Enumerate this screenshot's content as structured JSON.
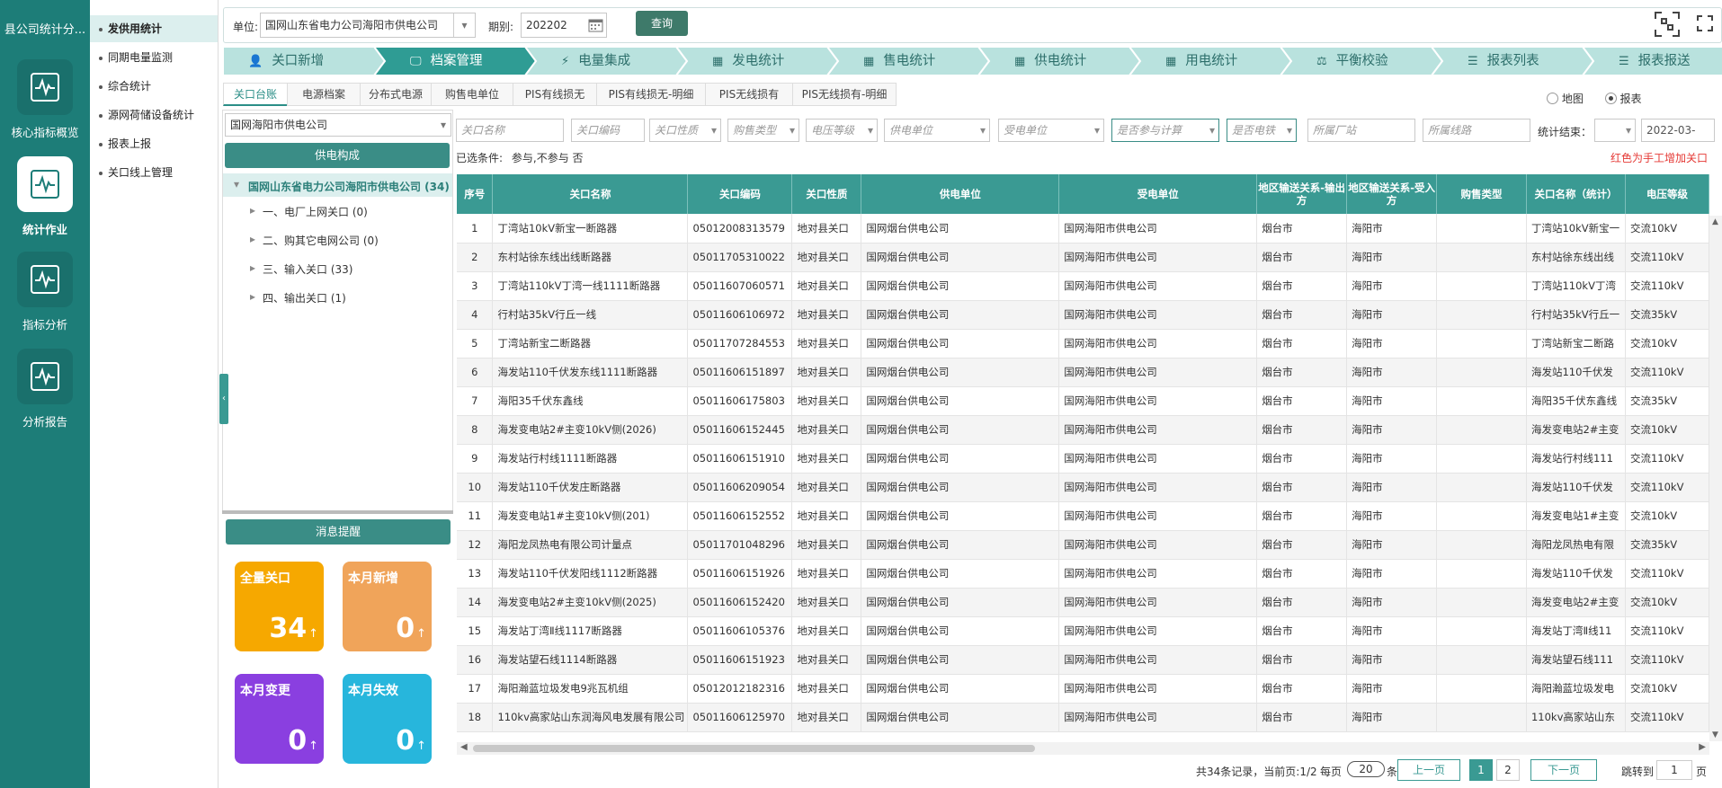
{
  "app": {
    "title": "县公司统计分..."
  },
  "nav": [
    {
      "label": "核心指标概览",
      "icon": "pulse-icon"
    },
    {
      "label": "统计作业",
      "icon": "pulse-icon"
    },
    {
      "label": "指标分析",
      "icon": "pulse-icon"
    },
    {
      "label": "分析报告",
      "icon": "pulse-icon"
    }
  ],
  "submenu": [
    "发供用统计",
    "同期电量监测",
    "综合统计",
    "源网荷储设备统计",
    "报表上报",
    "关口线上管理"
  ],
  "topbar": {
    "unit_label": "单位:",
    "unit_value": "国网山东省电力公司海阳市供电公司",
    "period_label": "期别:",
    "period_value": "202202",
    "query_label": "查询"
  },
  "steps": [
    "关口新增",
    "档案管理",
    "电量集成",
    "发电统计",
    "售电统计",
    "供电统计",
    "用电统计",
    "平衡校验",
    "报表列表",
    "报表报送"
  ],
  "subtabs": [
    "关口台账",
    "电源档案",
    "分布式电源",
    "购售电单位",
    "PIS有线损无",
    "PIS有线损无-明细",
    "PIS无线损有",
    "PIS无线损有-明细"
  ],
  "view_toggle": {
    "map_label": "地图",
    "report_label": "报表"
  },
  "tree": {
    "org_select": "国网海阳市供电公司",
    "composition_button": "供电构成",
    "root": "国网山东省电力公司海阳市供电公司 (34)",
    "children": [
      "一、电厂上网关口 (0)",
      "二、购其它电网公司 (0)",
      "三、输入关口 (33)",
      "四、输出关口 (1)"
    ]
  },
  "messages": {
    "title": "消息提醒",
    "cards": [
      {
        "label": "全量关口",
        "value": "34",
        "arrow": "↑",
        "color": "#f6a800"
      },
      {
        "label": "本月新增",
        "value": "0",
        "arrow": "↑",
        "color": "#f0a45a"
      },
      {
        "label": "本月变更",
        "value": "0",
        "arrow": "↑",
        "color": "#8a3fe0"
      },
      {
        "label": "本月失效",
        "value": "0",
        "arrow": "↑",
        "color": "#27b6dc"
      }
    ]
  },
  "filters": {
    "placeholders": [
      "关口名称",
      "关口编码",
      "关口性质",
      "购售类型",
      "电压等级",
      "供电单位",
      "受电单位",
      "是否参与计算",
      "是否电铁",
      "所属厂站",
      "所属线路"
    ],
    "stat_label": "统计结束：",
    "stat_date": "2022-03-",
    "selected_label": "已选条件:",
    "selected_value": "参与,不参与  否",
    "note": "红色为手工增加关口"
  },
  "table": {
    "headers": [
      "序号",
      "关口名称",
      "关口编码",
      "关口性质",
      "供电单位",
      "受电单位",
      "地区输送关系-输出方",
      "地区输送关系-受入方",
      "购售类型",
      "关口名称（统计）",
      "电压等级"
    ],
    "rows": [
      [
        "1",
        "丁湾站10kV新宝一断路器",
        "05012008313579",
        "地对县关口",
        "国网烟台供电公司",
        "国网海阳市供电公司",
        "烟台市",
        "海阳市",
        "",
        "丁湾站10kV新宝一",
        "交流10kV"
      ],
      [
        "2",
        "东村站徐东线出线断路器",
        "05011705310022",
        "地对县关口",
        "国网烟台供电公司",
        "国网海阳市供电公司",
        "烟台市",
        "海阳市",
        "",
        "东村站徐东线出线",
        "交流110kV"
      ],
      [
        "3",
        "丁湾站110kV丁湾一线1111断路器",
        "05011607060571",
        "地对县关口",
        "国网烟台供电公司",
        "国网海阳市供电公司",
        "烟台市",
        "海阳市",
        "",
        "丁湾站110kV丁湾",
        "交流110kV"
      ],
      [
        "4",
        "行村站35kV行丘一线",
        "05011606106972",
        "地对县关口",
        "国网烟台供电公司",
        "国网海阳市供电公司",
        "烟台市",
        "海阳市",
        "",
        "行村站35kV行丘一",
        "交流35kV"
      ],
      [
        "5",
        "丁湾站新宝二断路器",
        "05011707284553",
        "地对县关口",
        "国网烟台供电公司",
        "国网海阳市供电公司",
        "烟台市",
        "海阳市",
        "",
        "丁湾站新宝二断路",
        "交流10kV"
      ],
      [
        "6",
        "海发站110千伏发东线1111断路器",
        "05011606151897",
        "地对县关口",
        "国网烟台供电公司",
        "国网海阳市供电公司",
        "烟台市",
        "海阳市",
        "",
        "海发站110千伏发",
        "交流110kV"
      ],
      [
        "7",
        "海阳35千伏东鑫线",
        "05011606175803",
        "地对县关口",
        "国网烟台供电公司",
        "国网海阳市供电公司",
        "烟台市",
        "海阳市",
        "",
        "海阳35千伏东鑫线",
        "交流35kV"
      ],
      [
        "8",
        "海发变电站2#主变10kV侧(2026)",
        "05011606152445",
        "地对县关口",
        "国网烟台供电公司",
        "国网海阳市供电公司",
        "烟台市",
        "海阳市",
        "",
        "海发变电站2#主变",
        "交流10kV"
      ],
      [
        "9",
        "海发站行村线1111断路器",
        "05011606151910",
        "地对县关口",
        "国网烟台供电公司",
        "国网海阳市供电公司",
        "烟台市",
        "海阳市",
        "",
        "海发站行村线111",
        "交流110kV"
      ],
      [
        "10",
        "海发站110千伏发庄断路器",
        "05011606209054",
        "地对县关口",
        "国网烟台供电公司",
        "国网海阳市供电公司",
        "烟台市",
        "海阳市",
        "",
        "海发站110千伏发",
        "交流110kV"
      ],
      [
        "11",
        "海发变电站1#主变10kV侧(201)",
        "05011606152552",
        "地对县关口",
        "国网烟台供电公司",
        "国网海阳市供电公司",
        "烟台市",
        "海阳市",
        "",
        "海发变电站1#主变",
        "交流10kV"
      ],
      [
        "12",
        "海阳龙凤热电有限公司计量点",
        "05011701048296",
        "地对县关口",
        "国网烟台供电公司",
        "国网海阳市供电公司",
        "烟台市",
        "海阳市",
        "",
        "海阳龙凤热电有限",
        "交流35kV"
      ],
      [
        "13",
        "海发站110千伏发阳线1112断路器",
        "05011606151926",
        "地对县关口",
        "国网烟台供电公司",
        "国网海阳市供电公司",
        "烟台市",
        "海阳市",
        "",
        "海发站110千伏发",
        "交流110kV"
      ],
      [
        "14",
        "海发变电站2#主变10kV侧(2025)",
        "05011606152420",
        "地对县关口",
        "国网烟台供电公司",
        "国网海阳市供电公司",
        "烟台市",
        "海阳市",
        "",
        "海发变电站2#主变",
        "交流10kV"
      ],
      [
        "15",
        "海发站丁湾Ⅱ线1117断路器",
        "05011606105376",
        "地对县关口",
        "国网烟台供电公司",
        "国网海阳市供电公司",
        "烟台市",
        "海阳市",
        "",
        "海发站丁湾Ⅱ线11",
        "交流110kV"
      ],
      [
        "16",
        "海发站望石线1114断路器",
        "05011606151923",
        "地对县关口",
        "国网烟台供电公司",
        "国网海阳市供电公司",
        "烟台市",
        "海阳市",
        "",
        "海发站望石线111",
        "交流110kV"
      ],
      [
        "17",
        "海阳瀚蓝垃圾发电9兆瓦机组",
        "05012012182316",
        "地对县关口",
        "国网烟台供电公司",
        "国网海阳市供电公司",
        "烟台市",
        "海阳市",
        "",
        "海阳瀚蓝垃圾发电",
        "交流10kV"
      ],
      [
        "18",
        "110kv高家站山东润海风电发展有限公司",
        "05011606125970",
        "地对县关口",
        "国网烟台供电公司",
        "国网海阳市供电公司",
        "烟台市",
        "海阳市",
        "",
        "110kv高家站山东",
        "交流110kV"
      ]
    ]
  },
  "pager": {
    "summary": "共34条记录，当前页:1/2",
    "per_page_label": "每页",
    "per_page_value": "20",
    "per_page_suffix": "条",
    "prev": "上一页",
    "pages": [
      "1",
      "2"
    ],
    "next": "下一页",
    "jump_label": "跳转到",
    "jump_value": "1",
    "jump_suffix": "页"
  },
  "colors": {
    "primary": "#1d7d78",
    "accent": "#3a9a93",
    "note": "#e53935"
  }
}
